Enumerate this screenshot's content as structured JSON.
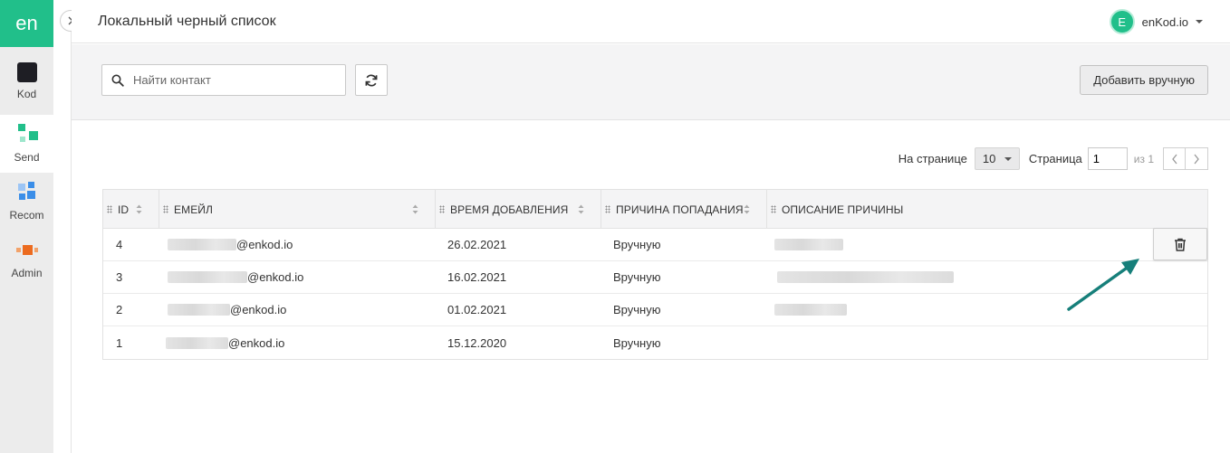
{
  "sidebar": {
    "logo": "en",
    "items": [
      {
        "label": "Kod"
      },
      {
        "label": "Send"
      },
      {
        "label": "Recom"
      },
      {
        "label": "Admin"
      }
    ]
  },
  "header": {
    "title": "Локальный черный список",
    "user_initial": "E",
    "user_name": "enKod.io"
  },
  "toolbar": {
    "search_placeholder": "Найти контакт",
    "add_label": "Добавить вручную"
  },
  "pager": {
    "per_page_label": "На странице",
    "per_page_value": "10",
    "page_label": "Страница",
    "page_value": "1",
    "of_label": "из 1"
  },
  "table": {
    "columns": [
      {
        "label": "ID"
      },
      {
        "label": "ЕМЕЙЛ"
      },
      {
        "label": "ВРЕМЯ ДОБАВЛЕНИЯ"
      },
      {
        "label": "ПРИЧИНА ПОПАДАНИЯ"
      },
      {
        "label": "ОПИСАНИЕ ПРИЧИНЫ"
      }
    ],
    "rows": [
      {
        "id": "4",
        "email": "@enkod.io",
        "date": "26.02.2021",
        "reason": "Вручную"
      },
      {
        "id": "3",
        "email": "@enkod.io",
        "date": "16.02.2021",
        "reason": "Вручную"
      },
      {
        "id": "2",
        "email": "@enkod.io",
        "date": "01.02.2021",
        "reason": "Вручную"
      },
      {
        "id": "1",
        "email": "@enkod.io",
        "date": "15.12.2020",
        "reason": "Вручную"
      }
    ]
  },
  "colors": {
    "brand": "#21bf8a",
    "annotation_arrow": "#167f7a"
  }
}
